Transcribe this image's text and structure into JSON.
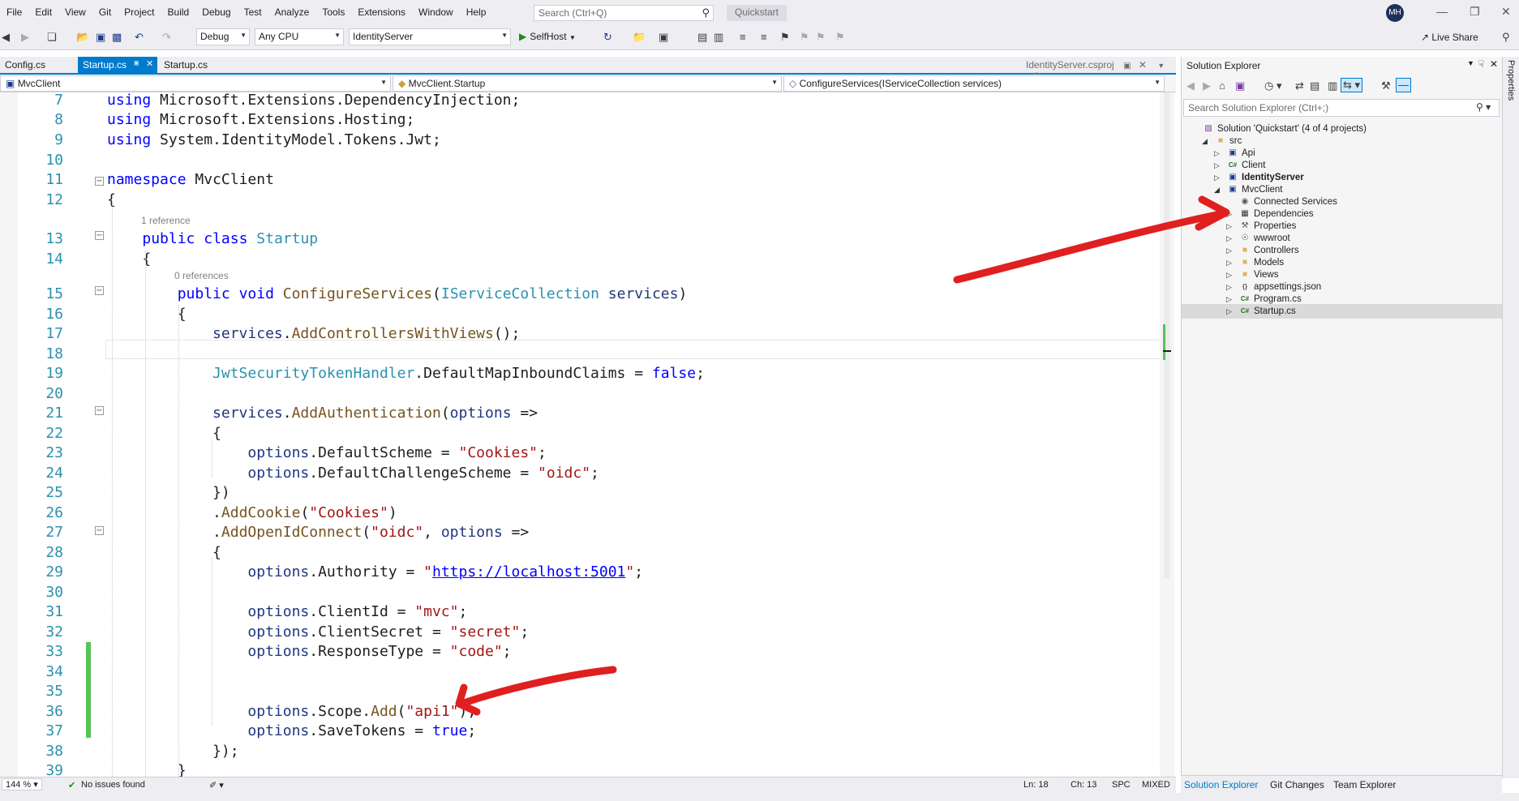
{
  "menu": [
    "File",
    "Edit",
    "View",
    "Git",
    "Project",
    "Build",
    "Debug",
    "Test",
    "Analyze",
    "Tools",
    "Extensions",
    "Window",
    "Help"
  ],
  "search": {
    "placeholder": "Search (Ctrl+Q)"
  },
  "solution_name_badge": "Quickstart",
  "user_initials": "MH",
  "toolbar": {
    "configuration": "Debug",
    "platform": "Any CPU",
    "startup_project": "IdentityServer",
    "run_label": "SelfHost",
    "live_share": "Live Share"
  },
  "tabs": [
    {
      "label": "Config.cs",
      "active": false
    },
    {
      "label": "Startup.cs",
      "active": true
    },
    {
      "label": "Startup.cs",
      "active": false
    }
  ],
  "preview_tab": "IdentityServer.csproj",
  "navbar": {
    "project": "MvcClient",
    "type": "MvcClient.Startup",
    "member": "ConfigureServices(IServiceCollection services)"
  },
  "codelens": {
    "class_refs": "1 reference",
    "method_refs": "0 references"
  },
  "code_lines": [
    {
      "n": "7",
      "html": "<span class=\"kw\">using</span> Microsoft.Extensions.DependencyInjection;"
    },
    {
      "n": "8",
      "html": "<span class=\"kw\">using</span> Microsoft.Extensions.Hosting;"
    },
    {
      "n": "9",
      "html": "<span class=\"kw\">using</span> System.IdentityModel.Tokens.Jwt;"
    },
    {
      "n": "10",
      "html": ""
    },
    {
      "n": "11",
      "html": "<span class=\"kw\">namespace</span> MvcClient"
    },
    {
      "n": "12",
      "html": "{"
    },
    {
      "n": "13",
      "html": "    <span class=\"kw\">public</span> <span class=\"kw\">class</span> <span class=\"ty\">Startup</span>"
    },
    {
      "n": "14",
      "html": "    {"
    },
    {
      "n": "15",
      "html": "        <span class=\"kw\">public</span> <span class=\"kw\">void</span> <span class=\"mt\">ConfigureServices</span>(<span class=\"ty\">IServiceCollection</span> <span class=\"vr\">services</span>)"
    },
    {
      "n": "16",
      "html": "        {"
    },
    {
      "n": "17",
      "html": "            <span class=\"vr\">services</span>.<span class=\"mt\">AddControllersWithViews</span>();"
    },
    {
      "n": "18",
      "html": ""
    },
    {
      "n": "19",
      "html": "            <span class=\"ty\">JwtSecurityTokenHandler</span>.DefaultMapInboundClaims = <span class=\"kw\">false</span>;"
    },
    {
      "n": "20",
      "html": ""
    },
    {
      "n": "21",
      "html": "            <span class=\"vr\">services</span>.<span class=\"mt\">AddAuthentication</span>(<span class=\"vr\">options</span> =>"
    },
    {
      "n": "22",
      "html": "            {"
    },
    {
      "n": "23",
      "html": "                <span class=\"vr\">options</span>.DefaultScheme = <span class=\"st\">\"Cookies\"</span>;"
    },
    {
      "n": "24",
      "html": "                <span class=\"vr\">options</span>.DefaultChallengeScheme = <span class=\"st\">\"oidc\"</span>;"
    },
    {
      "n": "25",
      "html": "            })"
    },
    {
      "n": "26",
      "html": "            .<span class=\"mt\">AddCookie</span>(<span class=\"st\">\"Cookies\"</span>)"
    },
    {
      "n": "27",
      "html": "            .<span class=\"mt\">AddOpenIdConnect</span>(<span class=\"st\">\"oidc\"</span>, <span class=\"vr\">options</span> =>"
    },
    {
      "n": "28",
      "html": "            {"
    },
    {
      "n": "29",
      "html": "                <span class=\"vr\">options</span>.Authority = <span class=\"st\">\"</span><span class=\"lk\">https://localhost:5001</span><span class=\"st\">\"</span>;"
    },
    {
      "n": "30",
      "html": ""
    },
    {
      "n": "31",
      "html": "                <span class=\"vr\">options</span>.ClientId = <span class=\"st\">\"mvc\"</span>;"
    },
    {
      "n": "32",
      "html": "                <span class=\"vr\">options</span>.ClientSecret = <span class=\"st\">\"secret\"</span>;"
    },
    {
      "n": "33",
      "html": "                <span class=\"vr\">options</span>.ResponseType = <span class=\"st\">\"code\"</span>;"
    },
    {
      "n": "34",
      "html": ""
    },
    {
      "n": "35",
      "html": ""
    },
    {
      "n": "36",
      "html": "                <span class=\"vr\">options</span>.Scope.<span class=\"mt\">Add</span>(<span class=\"st\">\"api1\"</span>);"
    },
    {
      "n": "37",
      "html": "                <span class=\"vr\">options</span>.SaveTokens = <span class=\"kw\">true</span>;"
    },
    {
      "n": "38",
      "html": "            });"
    },
    {
      "n": "39",
      "html": "        }"
    }
  ],
  "statusbar": {
    "zoom": "144 %",
    "issues": "No issues found",
    "ln": "Ln: 18",
    "ch": "Ch: 13",
    "spc": "SPC",
    "eol": "MIXED"
  },
  "solution_explorer": {
    "title": "Solution Explorer",
    "search_placeholder": "Search Solution Explorer (Ctrl+;)",
    "tree": [
      {
        "label": "Solution 'Quickstart' (4 of 4 projects)",
        "depth": 0,
        "icon": "solution-icon",
        "exp": ""
      },
      {
        "label": "src",
        "depth": 1,
        "icon": "folder-icon",
        "exp": "open"
      },
      {
        "label": "Api",
        "depth": 2,
        "icon": "web-project-icon",
        "exp": "closed"
      },
      {
        "label": "Client",
        "depth": 2,
        "icon": "csharp-project-icon",
        "exp": "closed"
      },
      {
        "label": "IdentityServer",
        "depth": 2,
        "icon": "web-project-icon",
        "exp": "closed",
        "bold": true
      },
      {
        "label": "MvcClient",
        "depth": 2,
        "icon": "web-project-icon",
        "exp": "open"
      },
      {
        "label": "Connected Services",
        "depth": 3,
        "icon": "connected-services-icon",
        "exp": ""
      },
      {
        "label": "Dependencies",
        "depth": 3,
        "icon": "dependencies-icon",
        "exp": "closed"
      },
      {
        "label": "Properties",
        "depth": 3,
        "icon": "properties-icon",
        "exp": "closed"
      },
      {
        "label": "wwwroot",
        "depth": 3,
        "icon": "globe-icon",
        "exp": "closed"
      },
      {
        "label": "Controllers",
        "depth": 3,
        "icon": "folder-icon",
        "exp": "closed"
      },
      {
        "label": "Models",
        "depth": 3,
        "icon": "folder-icon",
        "exp": "closed"
      },
      {
        "label": "Views",
        "depth": 3,
        "icon": "folder-icon",
        "exp": "closed"
      },
      {
        "label": "appsettings.json",
        "depth": 3,
        "icon": "json-file-icon",
        "exp": "closed"
      },
      {
        "label": "Program.cs",
        "depth": 3,
        "icon": "csharp-file-icon",
        "exp": "closed"
      },
      {
        "label": "Startup.cs",
        "depth": 3,
        "icon": "csharp-file-icon",
        "exp": "closed",
        "selected": true
      }
    ],
    "bottom_tabs": [
      "Solution Explorer",
      "Git Changes",
      "Team Explorer"
    ]
  },
  "properties_label": "Properties",
  "colors": {
    "accent": "#007acc",
    "annotation_arrow": "#e02020",
    "change_bar": "#57c457"
  }
}
